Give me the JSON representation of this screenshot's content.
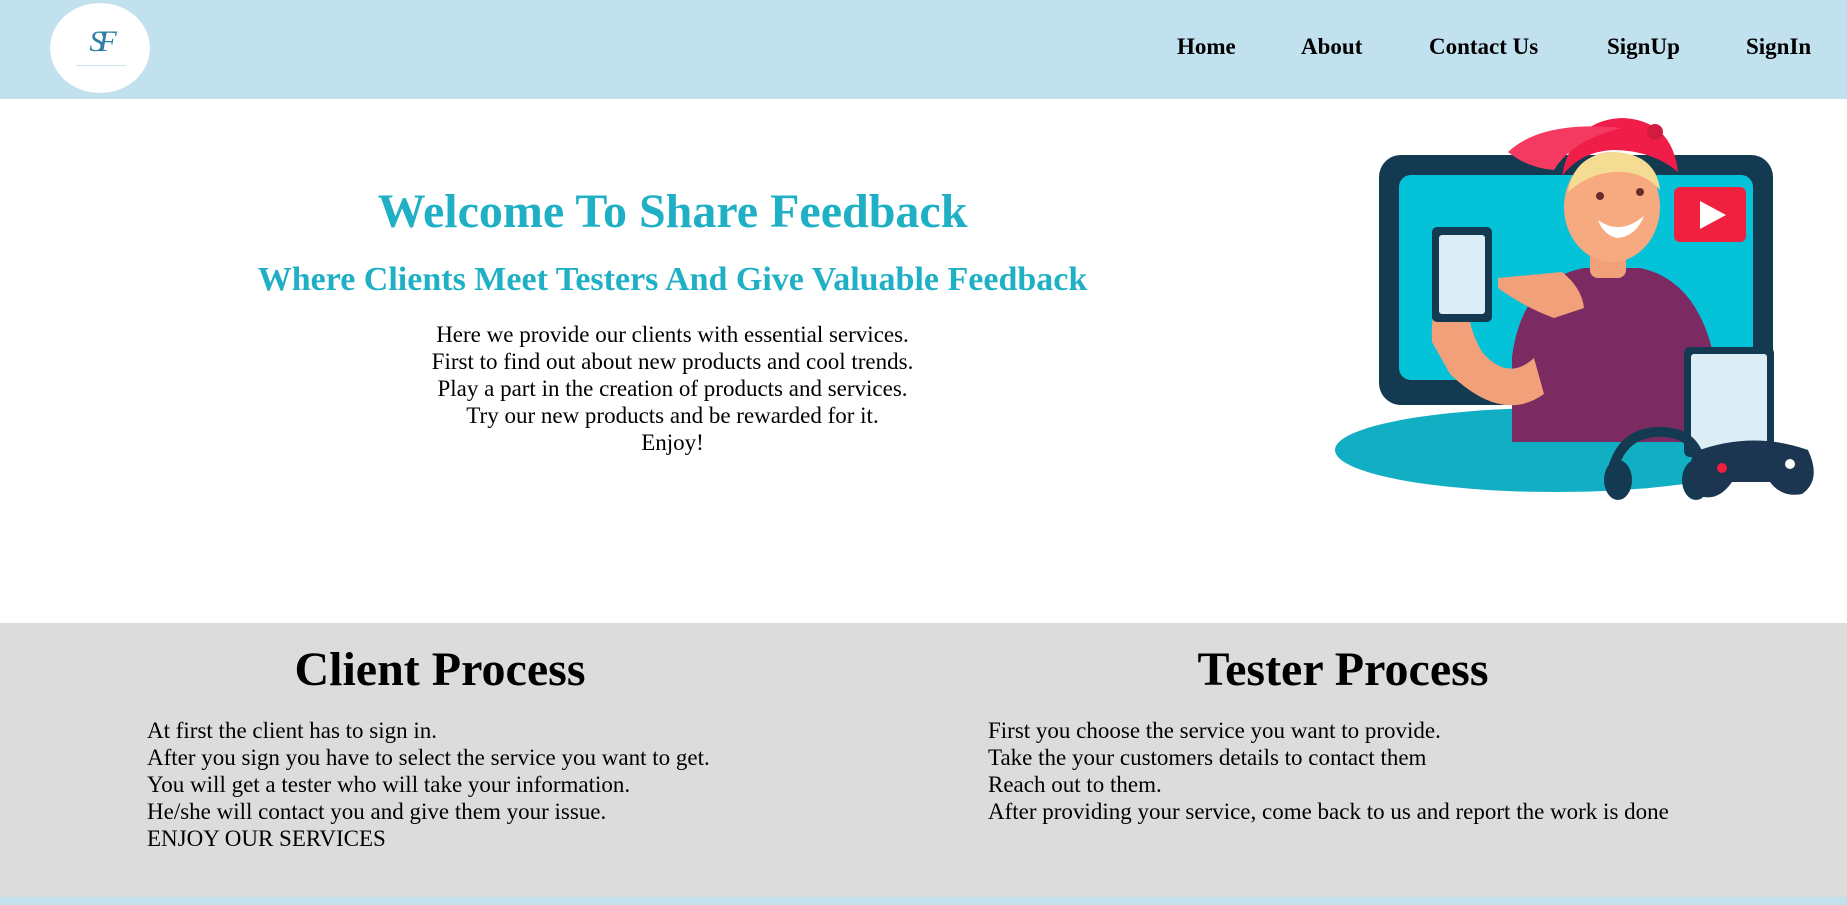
{
  "nav": {
    "logo_text": "SF",
    "links": [
      "Home",
      "About",
      "Contact Us",
      "SignUp",
      "SignIn"
    ]
  },
  "hero": {
    "title": "Welcome To Share Feedback",
    "subtitle": "Where Clients Meet Testers And Give Valuable Feedback",
    "lines": [
      "Here we provide our clients with essential services.",
      "First to find out about new products and cool trends.",
      "Play a part in the creation of products and services.",
      "Try our new products and be rewarded for it.",
      "Enjoy!"
    ]
  },
  "client_process": {
    "title": "Client Process",
    "steps": [
      "At first the client has to sign in.",
      "After you sign you have to select the service you want to get.",
      "You will get a tester who will take your information.",
      "He/she will contact you and give them your issue.",
      "ENJOY OUR SERVICES"
    ]
  },
  "tester_process": {
    "title": "Tester Process",
    "steps": [
      "First you choose the service you want to provide.",
      "Take the your customers details to contact them",
      "Reach out to them.",
      "After providing your service, come back to us and report the work is done"
    ]
  },
  "colors": {
    "nav_bg": "#c1e1ee",
    "accent": "#1fb0c6",
    "section_bg": "#dcdcdc"
  }
}
